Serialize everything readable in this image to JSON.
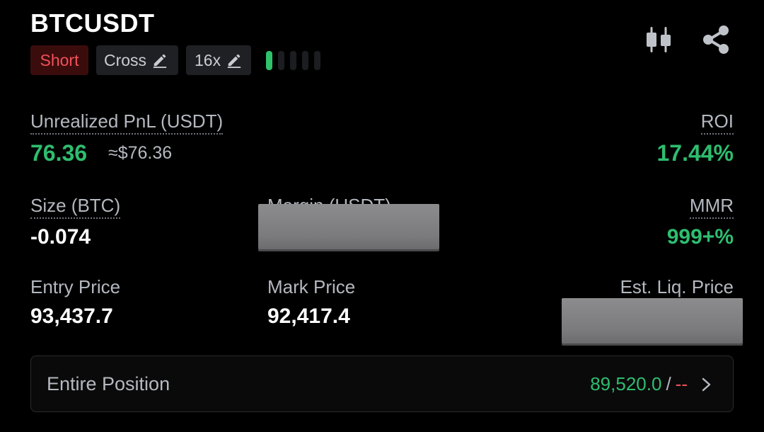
{
  "header": {
    "symbol": "BTCUSDT",
    "side": "Short",
    "margin_mode": "Cross",
    "leverage": "16x",
    "risk_level": 1,
    "risk_bars_total": 5
  },
  "pnl": {
    "label": "Unrealized PnL (USDT)",
    "value": "76.36",
    "approx": "≈$76.36"
  },
  "roi": {
    "label": "ROI",
    "value": "17.44%"
  },
  "size": {
    "label": "Size (BTC)",
    "value": "-0.074"
  },
  "margin": {
    "label": "Margin (USDT)"
  },
  "mmr": {
    "label": "MMR",
    "value": "999+%"
  },
  "entry": {
    "label": "Entry Price",
    "value": "93,437.7"
  },
  "mark": {
    "label": "Mark Price",
    "value": "92,417.4"
  },
  "liq": {
    "label": "Est. Liq. Price"
  },
  "position": {
    "label": "Entire Position",
    "take_profit": "89,520.0",
    "separator": "/",
    "stop_loss": "--"
  },
  "colors": {
    "green": "#2ebd6f",
    "red": "#f0515a",
    "background": "#000000"
  },
  "icons": [
    "pencil-icon",
    "candlestick-icon",
    "share-icon",
    "chevron-right-icon"
  ]
}
